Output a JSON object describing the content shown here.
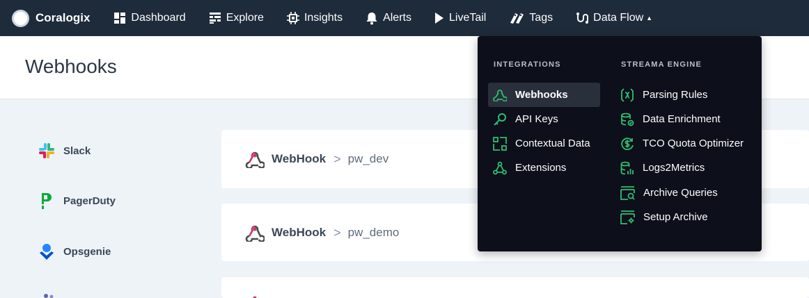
{
  "nav": {
    "brand": "Coralogix",
    "items": [
      {
        "label": "Dashboard",
        "icon": "dashboard-icon"
      },
      {
        "label": "Explore",
        "icon": "explore-icon"
      },
      {
        "label": "Insights",
        "icon": "insights-icon"
      },
      {
        "label": "Alerts",
        "icon": "bell-icon"
      },
      {
        "label": "LiveTail",
        "icon": "play-icon"
      },
      {
        "label": "Tags",
        "icon": "tags-icon"
      },
      {
        "label": "Data Flow",
        "icon": "data-flow-icon",
        "caret": "▲"
      }
    ]
  },
  "page": {
    "title": "Webhooks"
  },
  "sidebar": {
    "items": [
      {
        "label": "Slack",
        "icon": "slack-icon"
      },
      {
        "label": "PagerDuty",
        "icon": "pagerduty-icon"
      },
      {
        "label": "Opsgenie",
        "icon": "opsgenie-icon"
      }
    ]
  },
  "cards": [
    {
      "type": "WebHook",
      "separator": ">",
      "name": "pw_dev"
    },
    {
      "type": "WebHook",
      "separator": ">",
      "name": "pw_demo"
    }
  ],
  "dropdown": {
    "integrations": {
      "heading": "INTEGRATIONS",
      "items": [
        {
          "label": "Webhooks",
          "icon": "webhook-icon",
          "active": true
        },
        {
          "label": "API Keys",
          "icon": "key-icon"
        },
        {
          "label": "Contextual Data",
          "icon": "contextual-data-icon"
        },
        {
          "label": "Extensions",
          "icon": "extensions-icon"
        }
      ]
    },
    "streama": {
      "heading": "STREAMA ENGINE",
      "items": [
        {
          "label": "Parsing Rules",
          "icon": "parsing-rules-icon"
        },
        {
          "label": "Data Enrichment",
          "icon": "data-enrichment-icon"
        },
        {
          "label": "TCO Quota Optimizer",
          "icon": "tco-icon"
        },
        {
          "label": "Logs2Metrics",
          "icon": "logs2metrics-icon"
        },
        {
          "label": "Archive Queries",
          "icon": "archive-queries-icon"
        },
        {
          "label": "Setup Archive",
          "icon": "setup-archive-icon"
        }
      ]
    }
  },
  "colors": {
    "nav_bg": "#1e2b3a",
    "menu_bg": "#0d0f1a",
    "accent_green": "#2fbf71",
    "webhook_red": "#c73a63"
  }
}
